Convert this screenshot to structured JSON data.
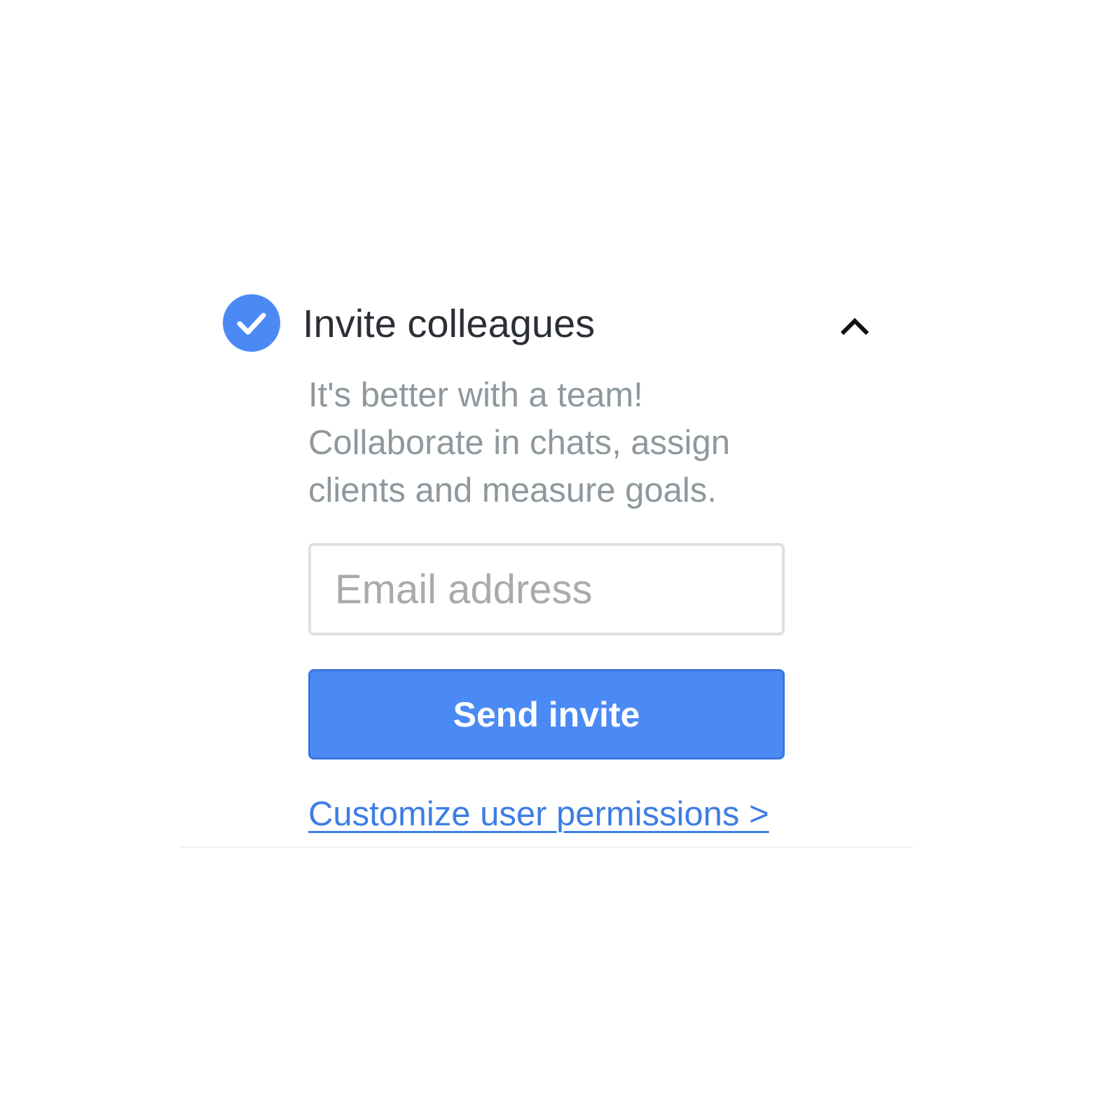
{
  "section": {
    "title": "Invite colleagues",
    "status_icon": "check-circle-icon",
    "toggle_icon": "chevron-up-icon",
    "description_lines": [
      "It's better with a team!",
      "Collaborate in chats, assign",
      "clients and measure goals."
    ],
    "email_input": {
      "placeholder": "Email address",
      "value": ""
    },
    "send_button_label": "Send invite",
    "permissions_link": "Customize user permissions >"
  },
  "colors": {
    "accent": "#4b8af5",
    "link": "#3d7de6",
    "title_text": "#2b2f36",
    "description_text": "#8e989d"
  }
}
